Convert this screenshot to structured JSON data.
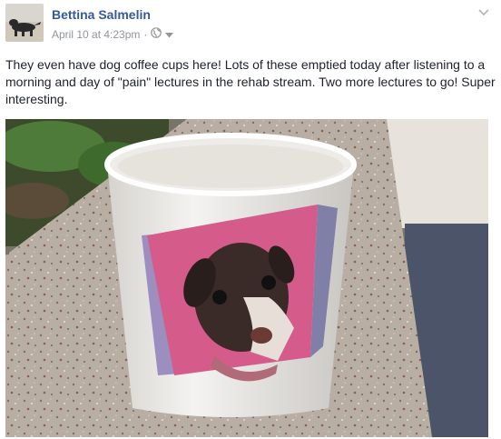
{
  "post": {
    "author_name": "Bettina Salmelin",
    "timestamp": "April 10 at 4:23pm",
    "separator": "·",
    "body_text": "They even have dog coffee cups here! Lots of these emptied today after listening to a morning and day of \"pain\" lectures in the rehab stream. Two more lectures to go! Super interesting."
  },
  "icons": {
    "privacy": "globe-icon",
    "audience_dropdown": "caret-down-icon",
    "post_menu": "chevron-down-icon"
  },
  "colors": {
    "author_link": "#365899",
    "meta_text": "#90949c",
    "body_text": "#1d2129"
  }
}
